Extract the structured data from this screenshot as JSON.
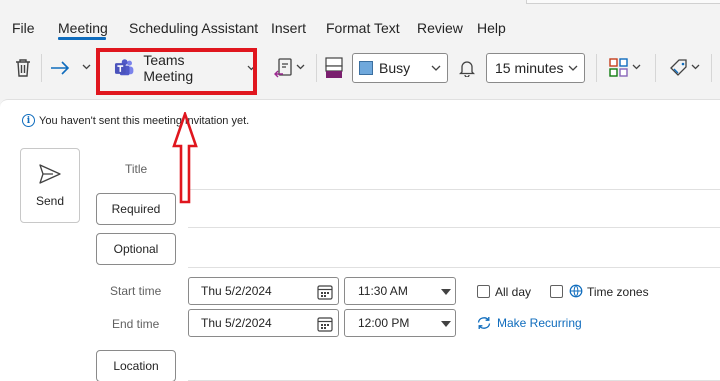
{
  "menu": {
    "tabs": [
      {
        "label": "File"
      },
      {
        "label": "Meeting"
      },
      {
        "label": "Scheduling Assistant"
      },
      {
        "label": "Insert"
      },
      {
        "label": "Format Text"
      },
      {
        "label": "Review"
      },
      {
        "label": "Help"
      }
    ],
    "active_tab": "Meeting"
  },
  "ribbon": {
    "teams_meeting_label": "Teams Meeting",
    "show_as_value": "Busy",
    "show_as_color": "#6fa8dc",
    "reminder_value": "15 minutes",
    "accent_color": "#0f6cbd",
    "highlight_color": "#e0161e"
  },
  "info_bar": {
    "text": "You haven't sent this meeting invitation yet."
  },
  "form": {
    "send_label": "Send",
    "title_label": "Title",
    "required_label": "Required",
    "optional_label": "Optional",
    "start_time_label": "Start time",
    "end_time_label": "End time",
    "start_date": "Thu 5/2/2024",
    "start_time": "11:30 AM",
    "end_date": "Thu 5/2/2024",
    "end_time": "12:00 PM",
    "all_day_label": "All day",
    "time_zones_label": "Time zones",
    "make_recurring_label": "Make Recurring",
    "location_label": "Location"
  }
}
